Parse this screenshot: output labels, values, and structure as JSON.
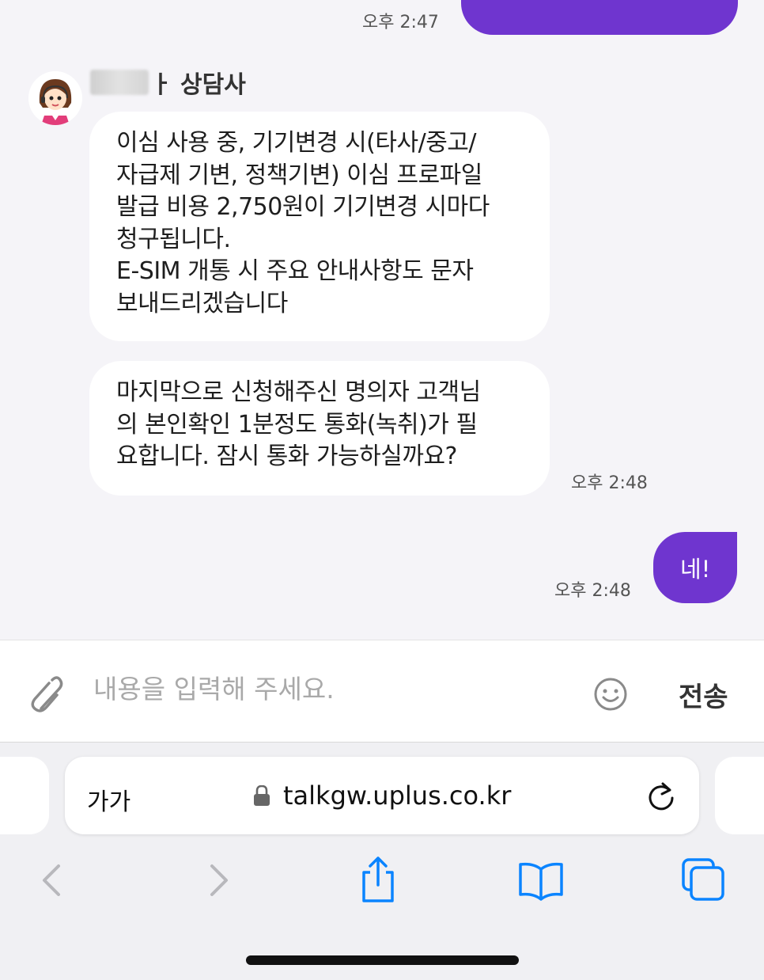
{
  "chat": {
    "messages": [
      {
        "type": "outgoing",
        "text": "",
        "time": "오후 2:47"
      },
      {
        "type": "agent_header",
        "name_suffix": "ㅏ 상담사"
      },
      {
        "type": "incoming",
        "text": "이심 사용 중, 기기변경 시(타사/중고/\n자급제 기변, 정책기변) 이심 프로파일\n발급 비용 2,750원이 기기변경 시마다\n청구됩니다.\nE-SIM 개통 시 주요 안내사항도 문자\n보내드리겠습니다"
      },
      {
        "type": "incoming",
        "text": "마지막으로 신청해주신 명의자 고객님\n의 본인확인 1분정도 통화(녹취)가 필\n요합니다. 잠시 통화 가능하실까요?",
        "time": "오후 2:48"
      },
      {
        "type": "outgoing",
        "text": "네!",
        "time": "오후 2:48"
      }
    ]
  },
  "input": {
    "placeholder": "내용을 입력해 주세요.",
    "send_label": "전송",
    "attach_icon": "paperclip-icon",
    "emoji_icon": "smiley-icon"
  },
  "browser": {
    "aa_label": "가가",
    "url": "talkgw.uplus.co.kr",
    "icons": [
      "back-icon",
      "forward-icon",
      "share-icon",
      "bookmarks-icon",
      "tabs-icon"
    ],
    "accent_color": "#0a84ff"
  },
  "colors": {
    "outgoing_bubble": "#6f35cf",
    "incoming_bubble": "#ffffff",
    "chat_bg": "#f5f4f8"
  }
}
